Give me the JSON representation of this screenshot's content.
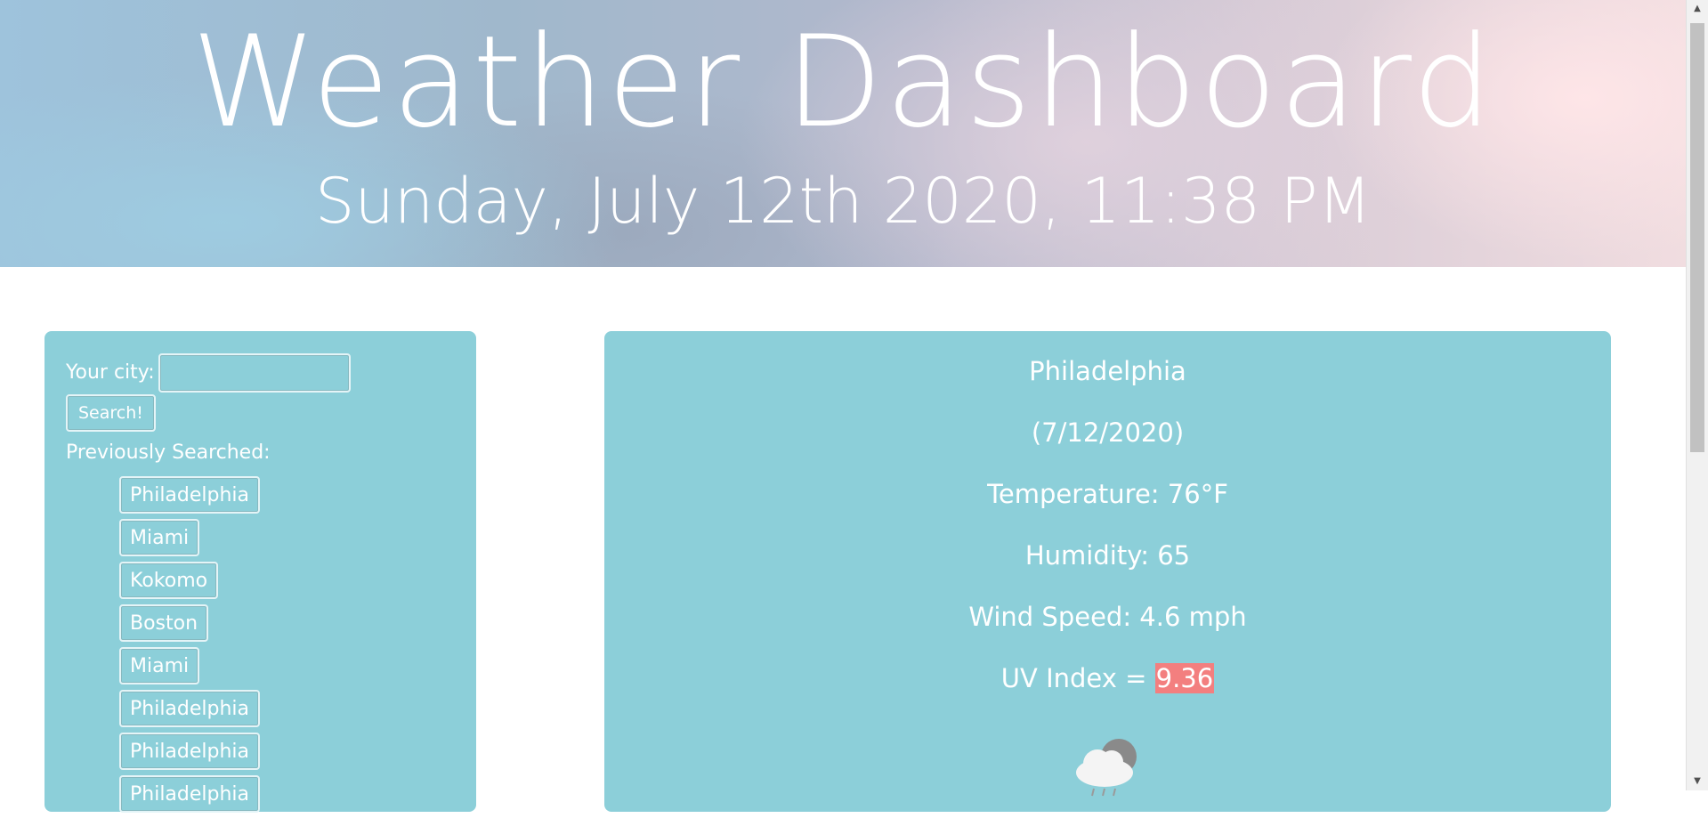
{
  "header": {
    "title": "Weather Dashboard",
    "datetime": "Sunday, July 12th 2020, 11:38 PM"
  },
  "search": {
    "label": "Your city:",
    "value": "",
    "button_label": "Search!"
  },
  "history": {
    "label": "Previously Searched:",
    "items": [
      "Philadelphia",
      "Miami",
      "Kokomo",
      "Boston",
      "Miami",
      "Philadelphia",
      "Philadelphia",
      "Philadelphia"
    ]
  },
  "current": {
    "city": "Philadelphia",
    "date": "(7/12/2020)",
    "temperature": "Temperature: 76°F",
    "humidity": "Humidity: 65",
    "wind": "Wind Speed: 4.6 mph",
    "uv_label": "UV Index = ",
    "uv_value": "9.36",
    "uv_color": "#f37f7f",
    "icon": "rain-cloud-icon"
  },
  "colors": {
    "panel": "#8ccfd9",
    "text": "#ffffff"
  }
}
